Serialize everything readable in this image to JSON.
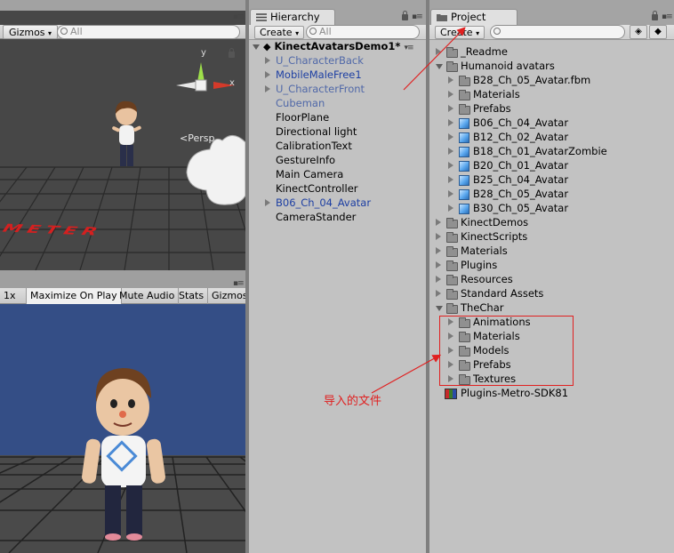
{
  "scene": {
    "gizmos_label": "Gizmos",
    "search_placeholder": "All",
    "persp_label": "Persp",
    "axis_x": "x",
    "axis_y": "y",
    "floor_text": "METER"
  },
  "game": {
    "tabs": [
      "1x",
      "Maximize On Play",
      "Mute Audio",
      "Stats",
      "Gizmos"
    ],
    "background_color": "#344e86"
  },
  "hierarchy": {
    "tab_label": "Hierarchy",
    "create_label": "Create",
    "search_placeholder": "All",
    "scene_name": "KinectAvatarsDemo1*",
    "items": [
      {
        "label": "U_CharacterBack",
        "expandable": true,
        "prefab_style": "broken"
      },
      {
        "label": "MobileMaleFree1",
        "expandable": true,
        "prefab_style": "prefab"
      },
      {
        "label": "U_CharacterFront",
        "expandable": true,
        "prefab_style": "broken"
      },
      {
        "label": "Cubeman",
        "expandable": false,
        "prefab_style": "broken"
      },
      {
        "label": "FloorPlane",
        "expandable": false,
        "prefab_style": "none"
      },
      {
        "label": "Directional light",
        "expandable": false,
        "prefab_style": "none"
      },
      {
        "label": "CalibrationText",
        "expandable": false,
        "prefab_style": "none"
      },
      {
        "label": "GestureInfo",
        "expandable": false,
        "prefab_style": "none"
      },
      {
        "label": "Main Camera",
        "expandable": false,
        "prefab_style": "none"
      },
      {
        "label": "KinectController",
        "expandable": false,
        "prefab_style": "none"
      },
      {
        "label": "B06_Ch_04_Avatar",
        "expandable": true,
        "prefab_style": "prefab"
      },
      {
        "label": "CameraStander",
        "expandable": false,
        "prefab_style": "none"
      }
    ]
  },
  "project": {
    "tab_label": "Project",
    "create_label": "Create",
    "tree": [
      {
        "label": "_Readme",
        "depth": 0,
        "state": "collapsed",
        "icon": "folder-icon"
      },
      {
        "label": "Humanoid avatars",
        "depth": 0,
        "state": "expanded",
        "icon": "folder-icon"
      },
      {
        "label": "B28_Ch_05_Avatar.fbm",
        "depth": 1,
        "state": "collapsed",
        "icon": "folder-icon"
      },
      {
        "label": "Materials",
        "depth": 1,
        "state": "collapsed",
        "icon": "folder-icon"
      },
      {
        "label": "Prefabs",
        "depth": 1,
        "state": "collapsed",
        "icon": "folder-icon"
      },
      {
        "label": "B06_Ch_04_Avatar",
        "depth": 1,
        "state": "collapsed",
        "icon": "model-icon"
      },
      {
        "label": "B12_Ch_02_Avatar",
        "depth": 1,
        "state": "collapsed",
        "icon": "model-icon"
      },
      {
        "label": "B18_Ch_01_AvatarZombie",
        "depth": 1,
        "state": "collapsed",
        "icon": "model-icon"
      },
      {
        "label": "B20_Ch_01_Avatar",
        "depth": 1,
        "state": "collapsed",
        "icon": "model-icon"
      },
      {
        "label": "B25_Ch_04_Avatar",
        "depth": 1,
        "state": "collapsed",
        "icon": "model-icon"
      },
      {
        "label": "B28_Ch_05_Avatar",
        "depth": 1,
        "state": "collapsed",
        "icon": "model-icon"
      },
      {
        "label": "B30_Ch_05_Avatar",
        "depth": 1,
        "state": "collapsed",
        "icon": "model-icon"
      },
      {
        "label": "KinectDemos",
        "depth": 0,
        "state": "collapsed",
        "icon": "folder-icon"
      },
      {
        "label": "KinectScripts",
        "depth": 0,
        "state": "collapsed",
        "icon": "folder-icon"
      },
      {
        "label": "Materials",
        "depth": 0,
        "state": "collapsed",
        "icon": "folder-icon"
      },
      {
        "label": "Plugins",
        "depth": 0,
        "state": "collapsed",
        "icon": "folder-icon"
      },
      {
        "label": "Resources",
        "depth": 0,
        "state": "collapsed",
        "icon": "folder-icon"
      },
      {
        "label": "Standard Assets",
        "depth": 0,
        "state": "collapsed",
        "icon": "folder-icon"
      },
      {
        "label": "TheChar",
        "depth": 0,
        "state": "expanded",
        "icon": "folder-icon"
      },
      {
        "label": "Animations",
        "depth": 1,
        "state": "collapsed",
        "icon": "folder-icon"
      },
      {
        "label": "Materials",
        "depth": 1,
        "state": "collapsed",
        "icon": "folder-icon"
      },
      {
        "label": "Models",
        "depth": 1,
        "state": "collapsed",
        "icon": "folder-icon"
      },
      {
        "label": "Prefabs",
        "depth": 1,
        "state": "collapsed",
        "icon": "folder-icon"
      },
      {
        "label": "Textures",
        "depth": 1,
        "state": "collapsed",
        "icon": "folder-icon"
      },
      {
        "label": "Plugins-Metro-SDK81",
        "depth": 0,
        "state": "leaf",
        "icon": "package-icon"
      }
    ]
  },
  "annotation": {
    "text": "导入的文件",
    "color": "#e02020"
  }
}
